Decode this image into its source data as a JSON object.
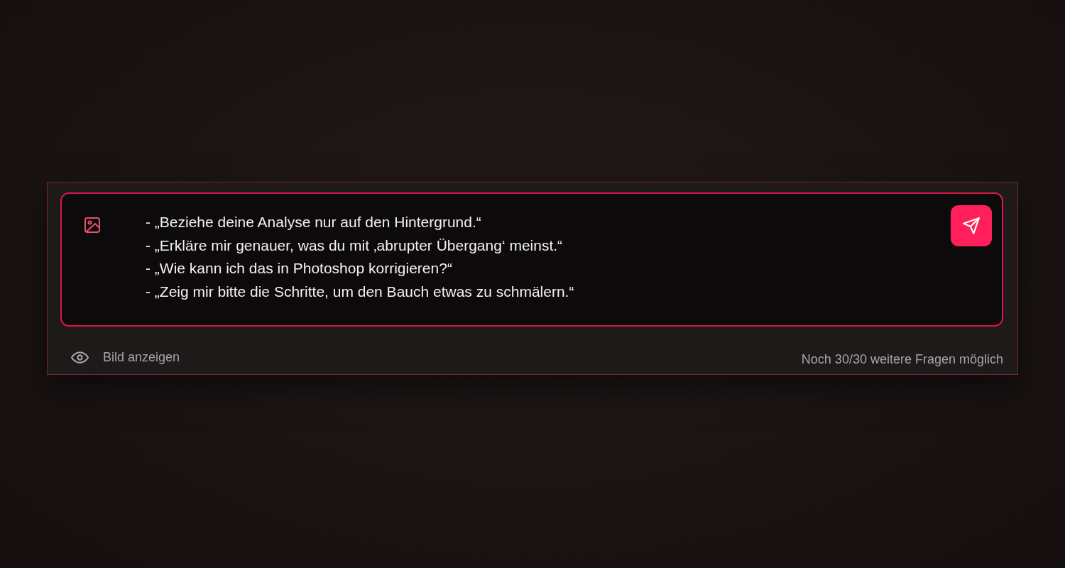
{
  "composer": {
    "message_lines": [
      "- „Beziehe deine Analyse nur auf den Hintergrund.“",
      "- „Erkläre mir genauer, was du mit ‚abrupter Übergang‘ meinst.“",
      "- „Wie kann ich das in Photoshop korrigieren?“",
      "- „Zeig mir bitte die Schritte, um den Bauch etwas zu schmälern.“"
    ]
  },
  "footer": {
    "show_image_label": "Bild anzeigen",
    "remaining_questions": "Noch 30/30 weitere Fragen möglich"
  }
}
